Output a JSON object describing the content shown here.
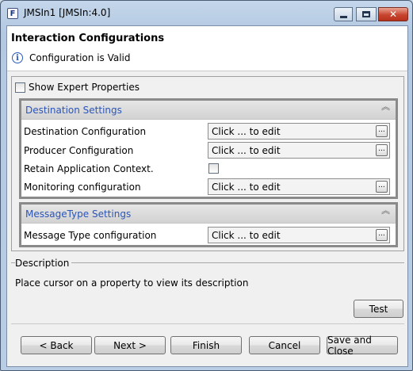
{
  "window": {
    "title": "JMSIn1 [JMSIn:4.0]",
    "app_icon_letter": "F",
    "controls": {
      "minimize": "min-icon",
      "maximize": "max-icon",
      "close": "close-icon"
    }
  },
  "header": {
    "title": "Interaction Configurations",
    "status": "Configuration is Valid"
  },
  "properties": {
    "show_expert_label": "Show Expert Properties",
    "show_expert_checked": false,
    "sections": [
      {
        "title": "Destination Settings",
        "rows": [
          {
            "label": "Destination Configuration",
            "type": "field",
            "value": "Click ... to edit"
          },
          {
            "label": "Producer Configuration",
            "type": "field",
            "value": "Click ... to edit"
          },
          {
            "label": "Retain Application Context.",
            "type": "checkbox",
            "checked": false
          },
          {
            "label": "Monitoring configuration",
            "type": "field",
            "value": "Click ... to edit"
          }
        ]
      },
      {
        "title": "MessageType Settings",
        "rows": [
          {
            "label": "Message Type configuration",
            "type": "field",
            "value": "Click ... to edit"
          }
        ]
      }
    ],
    "edit_button_label": "..."
  },
  "description": {
    "title": "Description",
    "text": "Place cursor on a property to view its description"
  },
  "buttons": {
    "test": "Test",
    "back": "< Back",
    "next": "Next >",
    "finish": "Finish",
    "cancel": "Cancel",
    "save_close": "Save and Close"
  }
}
